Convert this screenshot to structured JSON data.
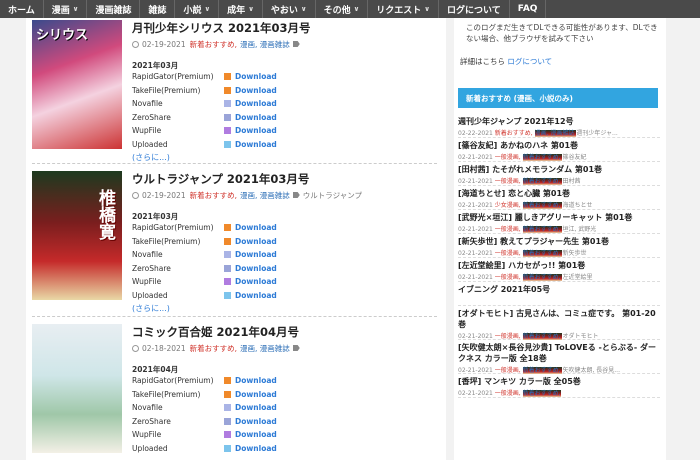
{
  "nav": [
    {
      "label": "ホーム",
      "caret": false
    },
    {
      "label": "漫画",
      "caret": true
    },
    {
      "label": "漫画雑誌",
      "caret": false
    },
    {
      "label": "雑誌",
      "caret": false
    },
    {
      "label": "小説",
      "caret": true
    },
    {
      "label": "成年",
      "caret": true
    },
    {
      "label": "やおい",
      "caret": true
    },
    {
      "label": "その他",
      "caret": true
    },
    {
      "label": "リクエスト",
      "caret": true
    },
    {
      "label": "ログについて",
      "caret": false
    },
    {
      "label": "FAQ",
      "caret": false
    }
  ],
  "posts": [
    {
      "title": "月刊少年シリウス 2021年03月号",
      "date": "02-19-2021",
      "cats": "新着おすすめ,",
      "cats2": "漫画, 漫画雑誌",
      "tagname": "",
      "cover_text": "シリウス",
      "month": "2021年03月",
      "hosts": [
        "RapidGator(Premium)",
        "TakeFile(Premium)",
        "Novafile",
        "ZeroShare",
        "WupFile",
        "Uploaded"
      ],
      "more": "(さらに...)"
    },
    {
      "title": "ウルトラジャンプ 2021年03月号",
      "date": "02-19-2021",
      "cats": "新着おすすめ,",
      "cats2": "漫画, 漫画雑誌",
      "tagname": "ウルトラジャンプ",
      "cover_text": "",
      "cover_big": "椎橋寛",
      "month": "2021年03月",
      "hosts": [
        "RapidGator(Premium)",
        "TakeFile(Premium)",
        "Novafile",
        "ZeroShare",
        "WupFile",
        "Uploaded"
      ],
      "more": "(さらに...)"
    },
    {
      "title": "コミック百合姫 2021年04月号",
      "date": "02-18-2021",
      "cats": "新着おすすめ,",
      "cats2": "漫画, 漫画雑誌",
      "tagname": "",
      "cover_text": "",
      "month": "2021年04月",
      "hosts": [
        "RapidGator(Premium)",
        "TakeFile(Premium)",
        "Novafile",
        "ZeroShare",
        "WupFile",
        "Uploaded"
      ]
    }
  ],
  "download_label": "Download",
  "host_colors": [
    "#f0892a",
    "#f0892a",
    "#aab4e6",
    "#9aa4d8",
    "#b07ce0",
    "#7cc4ec"
  ],
  "sidebar": {
    "note": "このログまだ生きてDLできる可能性があります、DLできない場合、他ブラウザを試みて下さい",
    "detail_prefix": "詳細はこちら",
    "detail_link": "ログについて",
    "heading": "新着おすすめ (漫画、小説のみ)",
    "items": [
      {
        "title": "週刊少年ジャンプ 2021年12号",
        "date": "02-22-2021",
        "c": "新着おすすめ,",
        "c2": "漫画, 漫画雑誌",
        "tag": "週刊少年ジャ..."
      },
      {
        "title": "[篠谷友紀] あかねのハネ 第01巻",
        "date": "02-21-2021",
        "c": "一般漫画,",
        "c2": "新着おすすめ,",
        "tag": "篠谷友紀"
      },
      {
        "title": "[田村茜] たそがれメモランダム 第01巻",
        "date": "02-21-2021",
        "c": "一般漫画,",
        "c2": "新着おすすめ,",
        "tag": "田村茜"
      },
      {
        "title": "[海道ちとせ] 恋と心臓 第01巻",
        "date": "02-21-2021",
        "c": "少女漫画,",
        "c2": "新着おすすめ,",
        "tag": "海道ちとせ"
      },
      {
        "title": "[武野光×垣江] 麗しきアグリーキャット 第01巻",
        "date": "02-21-2021",
        "c": "一般漫画,",
        "c2": "新着おすすめ,",
        "tag": "垣江, 武野光"
      },
      {
        "title": "[新矢歩世] 教えてプラジャー先生 第01巻",
        "date": "02-21-2021",
        "c": "一般漫画,",
        "c2": "新着おすすめ,",
        "tag": "新矢歩世"
      },
      {
        "title": "[左近堂絵里] ハカセがっ!! 第01巻",
        "date": "02-21-2021",
        "c": "一般漫画,",
        "c2": "新着おすすめ,",
        "tag": "左近堂絵里"
      },
      {
        "title": "イブニング 2021年05号",
        "date": "",
        "c": "",
        "c2": "",
        "tag": ""
      },
      {
        "title": "[オダトモヒト] 古見さんは、コミュ症です。 第01-20巻",
        "date": "02-21-2021",
        "c": "一般漫画,",
        "c2": "新着おすすめ,",
        "tag": "オダトモヒト"
      },
      {
        "title": "[矢吹健太朗×長谷見沙貴] ToLOVEる -とらぶる- ダークネス カラー版 全18巻",
        "date": "02-21-2021",
        "c": "一般漫画,",
        "c2": "新着おすすめ,",
        "tag": "矢吹健太朗, 長谷見..."
      },
      {
        "title": "[香坪] マンキツ カラー版 全05巻",
        "date": "02-21-2021",
        "c": "一般漫画,",
        "c2": "新着おすすめ,",
        "tag": ""
      }
    ]
  }
}
